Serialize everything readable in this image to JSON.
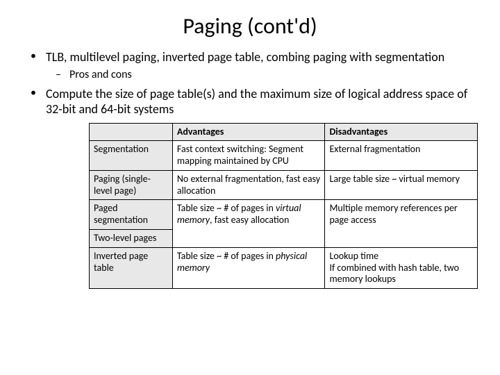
{
  "title": "Paging (cont'd)",
  "bullets": {
    "b1": "TLB, multilevel paging, inverted page table, combing paging with segmentation",
    "b1_sub1": "Pros and cons",
    "b2": "Compute the size of page table(s) and the maximum size of logical address space of 32-bit and 64-bit systems"
  },
  "table": {
    "headers": {
      "adv": "Advantages",
      "dis": "Disadvantages"
    },
    "rows": {
      "seg": {
        "name": "Segmentation",
        "adv": "Fast context switching: Segment mapping maintained by CPU",
        "dis": "External fragmentation"
      },
      "paging_single": {
        "name": "Paging (single-level page)",
        "adv": "No external fragmentation, fast easy allocation",
        "dis": "Large table size ~ virtual memory"
      },
      "paged_seg": {
        "name1": "Paged segmentation",
        "name2": "Two-level pages",
        "adv_pre": "Table size ~ # of pages in ",
        "adv_em": "virtual memory",
        "adv_post": ", fast easy allocation",
        "dis": "Multiple memory references per page access"
      },
      "inverted": {
        "name": "Inverted page table",
        "adv_pre": "Table size ~ # of pages in ",
        "adv_em": "physical memory",
        "dis": "Lookup time\nIf combined with hash table, two memory lookups"
      }
    }
  }
}
